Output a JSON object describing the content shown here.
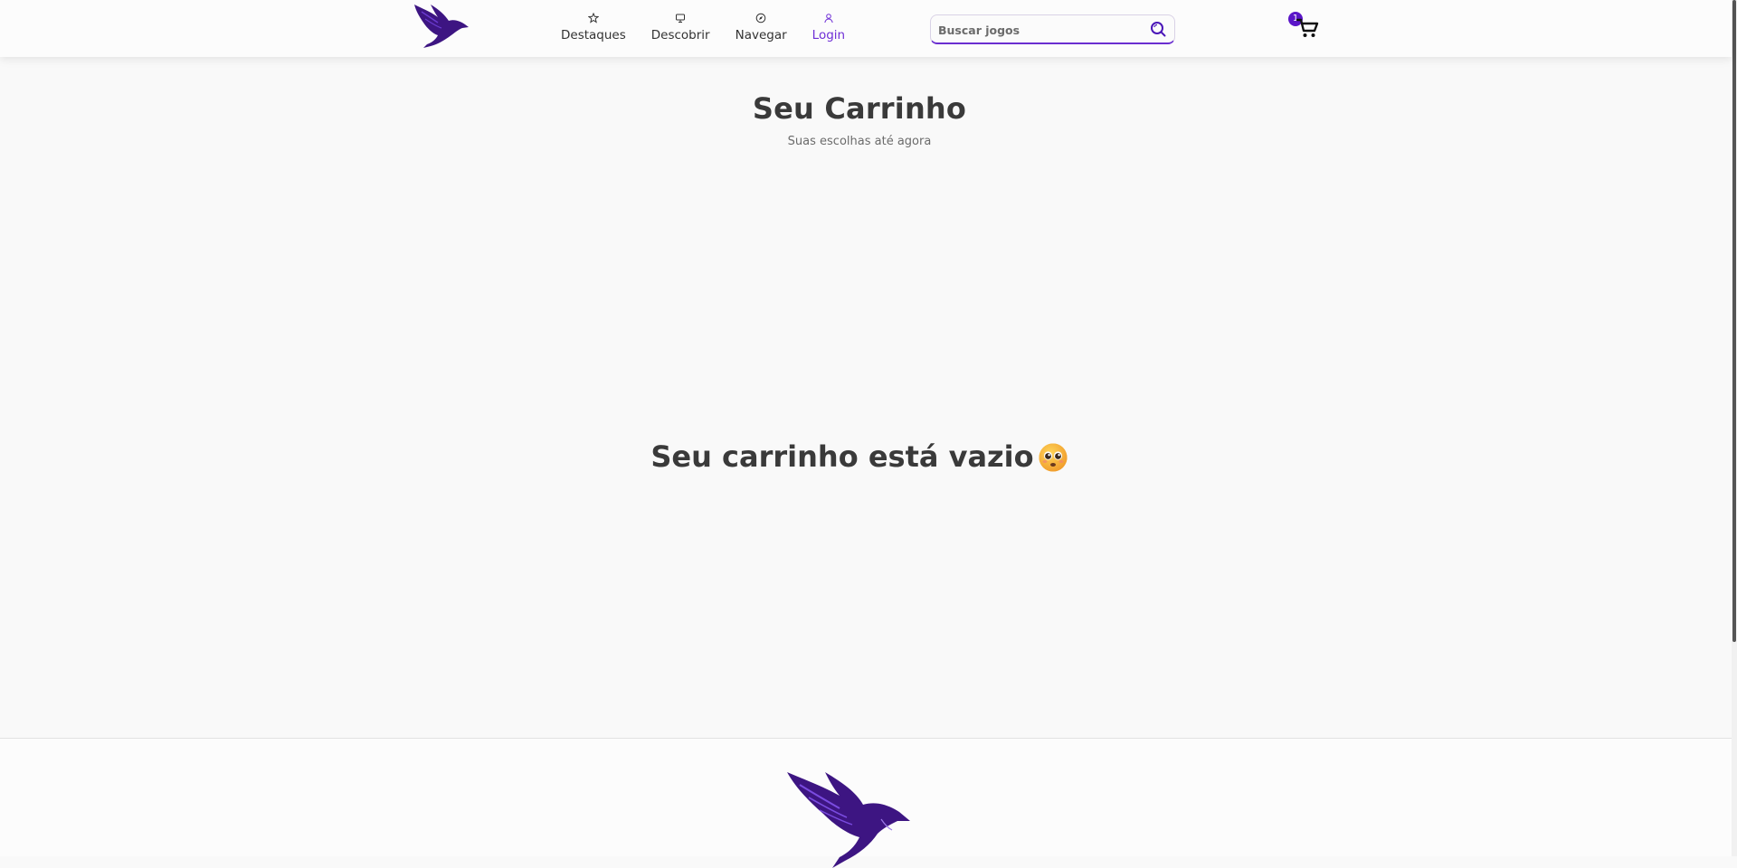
{
  "header": {
    "nav": [
      {
        "label": "Destaques",
        "icon": "star-icon"
      },
      {
        "label": "Descobrir",
        "icon": "monitor-icon"
      },
      {
        "label": "Navegar",
        "icon": "compass-icon"
      },
      {
        "label": "Login",
        "icon": "user-icon"
      }
    ],
    "search": {
      "placeholder": "Buscar jogos",
      "value": ""
    },
    "cart_count": "1"
  },
  "main": {
    "title": "Seu Carrinho",
    "subtitle": "Suas escolhas até agora",
    "empty_message": "Seu carrinho está vazio"
  },
  "colors": {
    "accent": "#6f2fd6",
    "brand_dark": "#3d1582",
    "badge": "#5b16c8",
    "background": "#f9f9f9"
  }
}
